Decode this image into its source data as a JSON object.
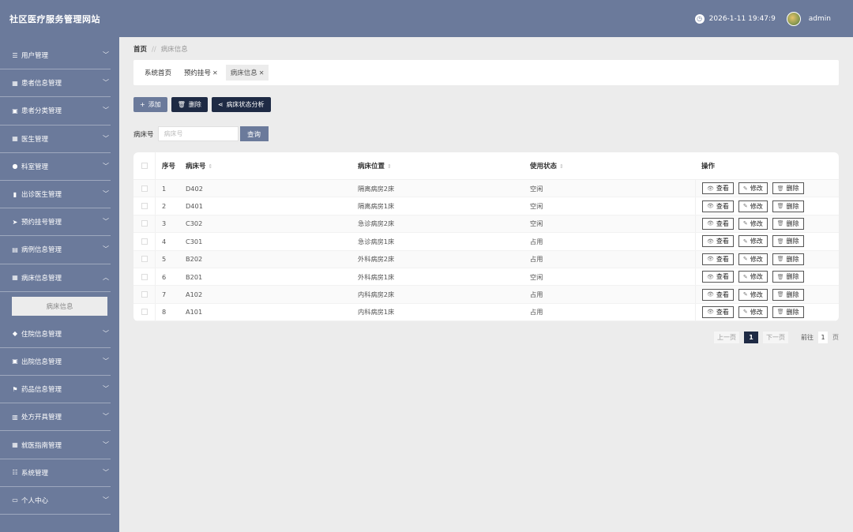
{
  "header": {
    "title": "社区医疗服务管理网站",
    "datetime": "2026-1-11 19:47:9",
    "username": "admin"
  },
  "sidebar": {
    "items": [
      {
        "label": "用户管理",
        "icon": "☰"
      },
      {
        "label": "患者信息管理",
        "icon": "▦"
      },
      {
        "label": "患者分类管理",
        "icon": "▣"
      },
      {
        "label": "医生管理",
        "icon": "▦"
      },
      {
        "label": "科室管理",
        "icon": "●"
      },
      {
        "label": "出诊医生管理",
        "icon": "▮"
      },
      {
        "label": "预约挂号管理",
        "icon": "➤"
      },
      {
        "label": "病例信息管理",
        "icon": "▤"
      },
      {
        "label": "病床信息管理",
        "icon": "▦"
      },
      {
        "label": "住院信息管理",
        "icon": "◆"
      },
      {
        "label": "出院信息管理",
        "icon": "▣"
      },
      {
        "label": "药品信息管理",
        "icon": "⚑"
      },
      {
        "label": "处方开具管理",
        "icon": "▥"
      },
      {
        "label": "就医指南管理",
        "icon": "▦"
      },
      {
        "label": "系统管理",
        "icon": "☷"
      },
      {
        "label": "个人中心",
        "icon": "▭"
      }
    ],
    "sub_item": "病床信息"
  },
  "breadcrumb": {
    "home": "首页",
    "sep": "//",
    "current": "病床信息"
  },
  "tabs": [
    {
      "label": "系统首页"
    },
    {
      "label": "预约挂号"
    },
    {
      "label": "病床信息"
    }
  ],
  "toolbar": {
    "add": "添加",
    "delete": "删除",
    "analysis": "病床状态分析"
  },
  "search": {
    "label": "病床号",
    "placeholder": "病床号",
    "button": "查询"
  },
  "table": {
    "headers": {
      "index": "序号",
      "bed_no": "病床号",
      "position": "病床位置",
      "status": "使用状态",
      "ops": "操作"
    },
    "rows": [
      {
        "index": "1",
        "bed_no": "D402",
        "position": "隔离病房2床",
        "status": "空闲"
      },
      {
        "index": "2",
        "bed_no": "D401",
        "position": "隔离病房1床",
        "status": "空闲"
      },
      {
        "index": "3",
        "bed_no": "C302",
        "position": "急诊病房2床",
        "status": "空闲"
      },
      {
        "index": "4",
        "bed_no": "C301",
        "position": "急诊病房1床",
        "status": "占用"
      },
      {
        "index": "5",
        "bed_no": "B202",
        "position": "外科病房2床",
        "status": "占用"
      },
      {
        "index": "6",
        "bed_no": "B201",
        "position": "外科病房1床",
        "status": "空闲"
      },
      {
        "index": "7",
        "bed_no": "A102",
        "position": "内科病房2床",
        "status": "占用"
      },
      {
        "index": "8",
        "bed_no": "A101",
        "position": "内科病房1床",
        "status": "占用"
      }
    ],
    "op_labels": {
      "view": "查看",
      "edit": "修改",
      "delete": "删除"
    }
  },
  "pager": {
    "prev": "上一页",
    "current": "1",
    "next": "下一页",
    "goto": "前往",
    "page_input": "1",
    "page_unit": "页"
  },
  "colors": {
    "primary": "#6b7a9b",
    "dark": "#1e2a44",
    "background": "#ececec"
  }
}
